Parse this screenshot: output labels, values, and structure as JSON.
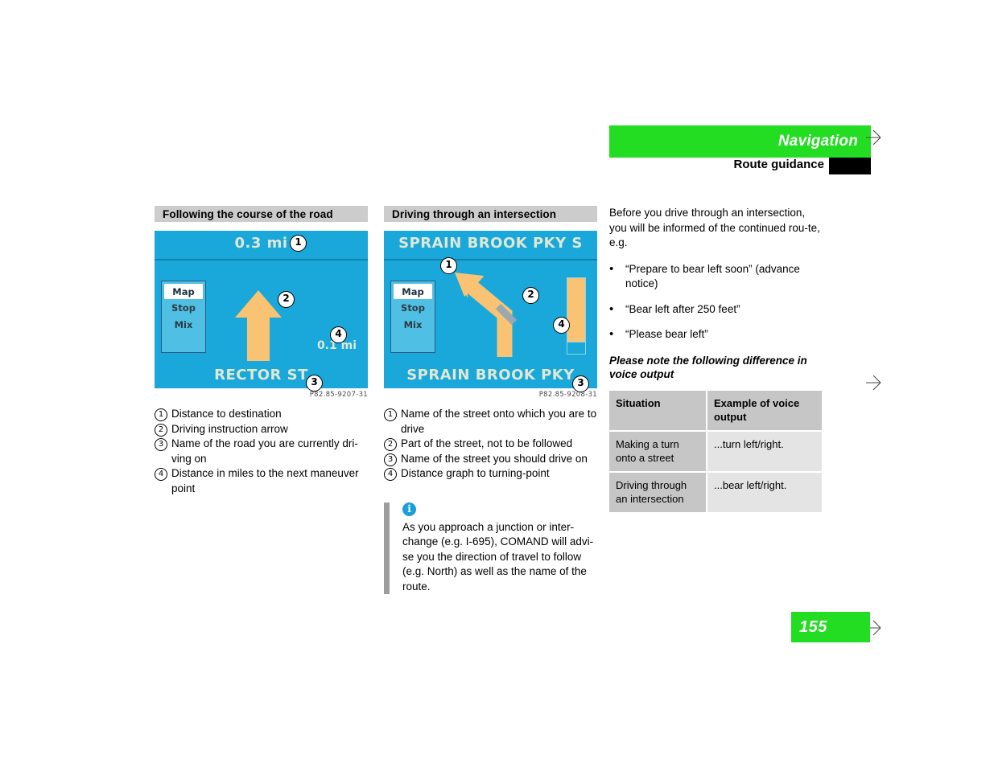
{
  "header": {
    "chapter": "Navigation",
    "section": "Route guidance"
  },
  "page_number": "155",
  "left_column": {
    "section_title": "Following the course of the road",
    "screenshot": {
      "top_text": "0.3 mi",
      "bottom_text": "RECTOR ST",
      "distance_label": "0.1 mi",
      "menu": [
        "Map",
        "Stop",
        "Mix"
      ],
      "image_code": "P82.85-9207-31",
      "callouts": [
        "1",
        "2",
        "3",
        "4"
      ]
    },
    "legend": [
      {
        "num": "1",
        "text": "Distance to destination"
      },
      {
        "num": "2",
        "text": "Driving instruction arrow"
      },
      {
        "num": "3",
        "text": "Name of the road you are currently dri-ving on"
      },
      {
        "num": "4",
        "text": "Distance in miles to the next maneuver point"
      }
    ]
  },
  "middle_column": {
    "section_title": "Driving through an intersection",
    "screenshot": {
      "top_text": "SPRAIN BROOK PKY S",
      "bottom_text": "SPRAIN BROOK PKY",
      "menu": [
        "Map",
        "Stop",
        "Mix"
      ],
      "image_code": "P82.85-9208-31",
      "callouts": [
        "1",
        "2",
        "3",
        "4"
      ]
    },
    "legend": [
      {
        "num": "1",
        "text": "Name of the street onto which you are to drive"
      },
      {
        "num": "2",
        "text": "Part of the street, not to be followed"
      },
      {
        "num": "3",
        "text": "Name of the street you should drive on"
      },
      {
        "num": "4",
        "text": "Distance graph to turning-point"
      }
    ],
    "note": {
      "icon": "info-icon",
      "text": "As you approach a junction or inter-change (e.g. I-695), COMAND will advi-se you the direction of travel to follow (e.g. North) as well as the name of the route."
    }
  },
  "right_column": {
    "intro": "Before you drive through an intersection, you will be informed of the continued rou-te, e.g.",
    "bullets": [
      "“Prepare to bear left soon” (advance notice)",
      "“Bear left after 250 feet”",
      "“Please bear left”"
    ],
    "sub_heading": "Please note the following difference in voice output",
    "table": {
      "headers": [
        "Situation",
        "Example of voice output"
      ],
      "rows": [
        [
          "Making a turn onto a street",
          "...turn left/right."
        ],
        [
          "Driving through an intersection",
          "...bear left/right."
        ]
      ]
    }
  },
  "colors": {
    "brand_green": "#22dd22",
    "screen_blue": "#1aa7da",
    "arrow_orange": "#f9c373",
    "bar_gray": "#cccccc",
    "info_blue": "#1b9fd8"
  }
}
